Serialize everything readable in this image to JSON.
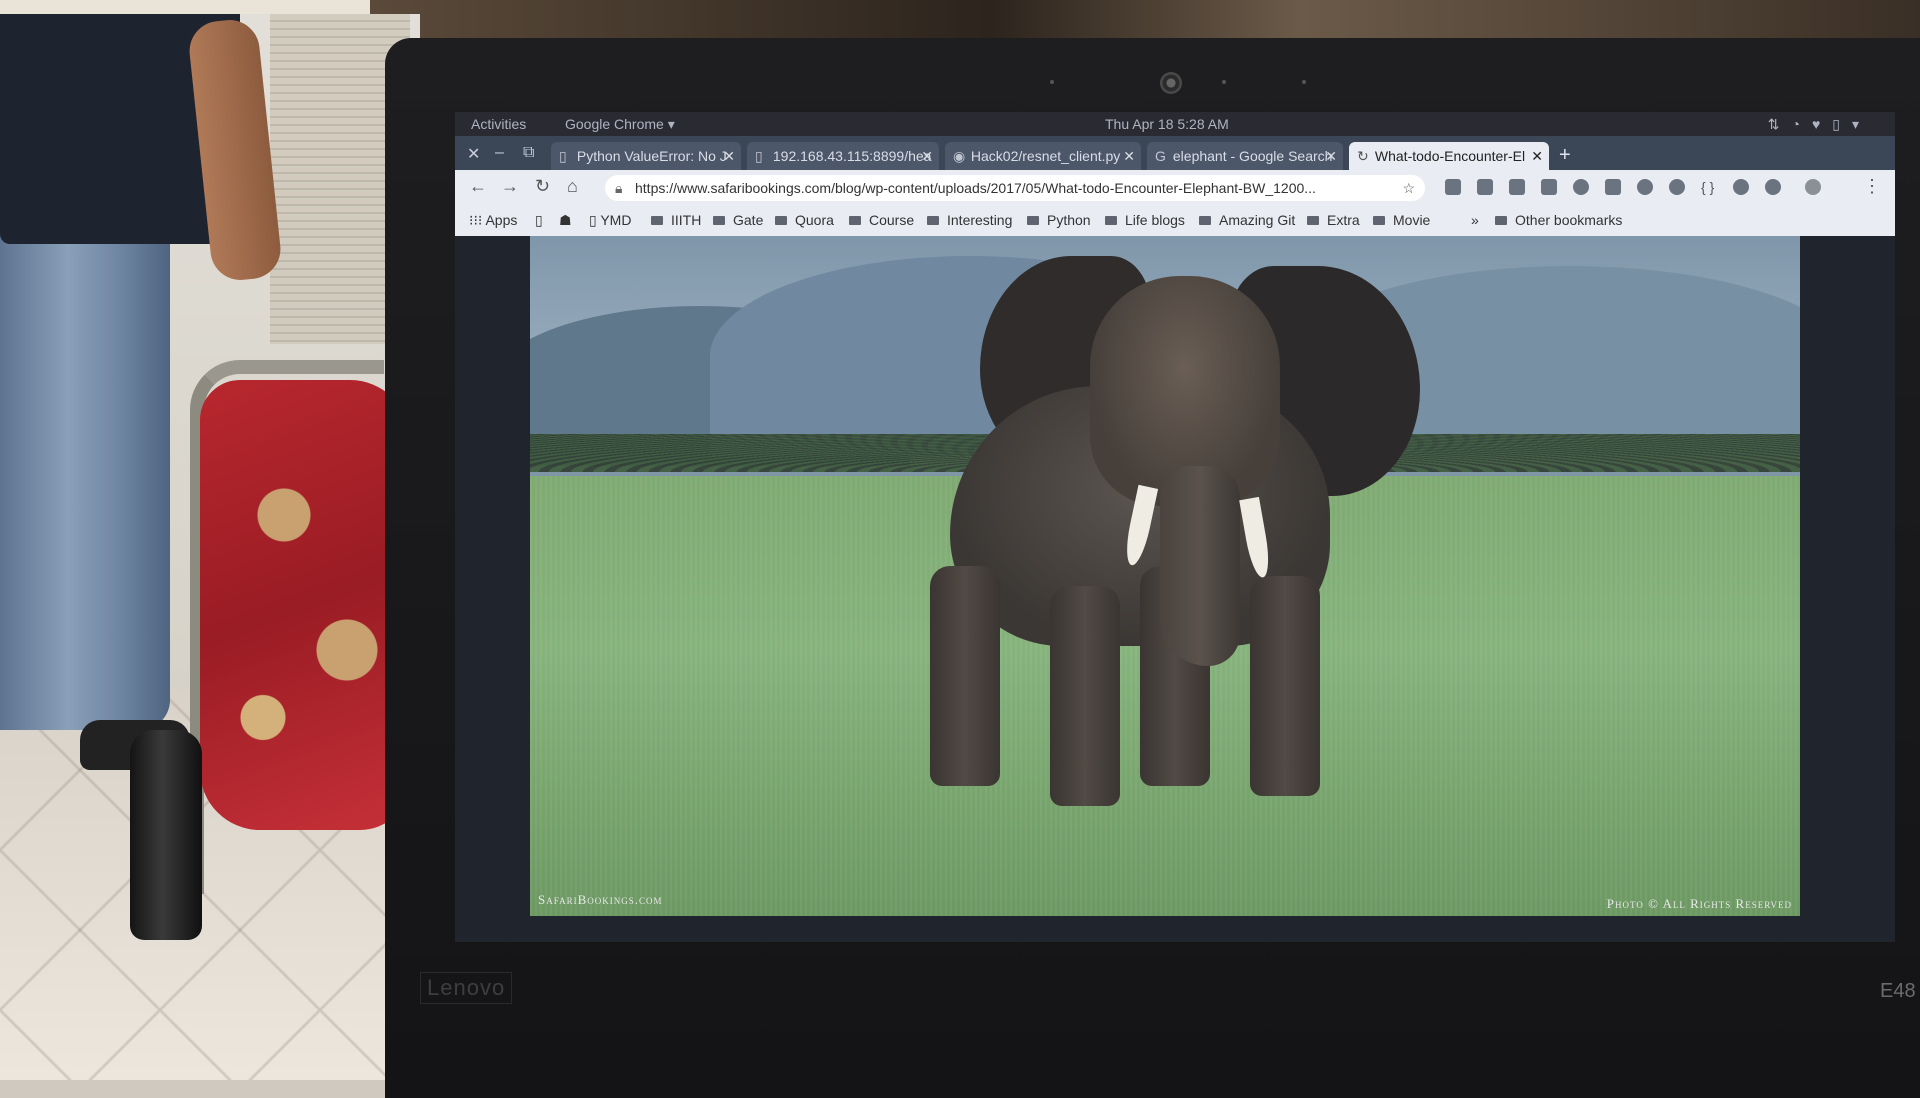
{
  "system_bar": {
    "activities": "Activities",
    "app_menu": "Google Chrome ▾",
    "clock": "Thu Apr 18  5:28 AM"
  },
  "tabs": [
    {
      "label": "Python ValueError: No J",
      "active": false
    },
    {
      "label": "192.168.43.115:8899/hea",
      "active": false
    },
    {
      "label": "Hack02/resnet_client.py",
      "active": false
    },
    {
      "label": "elephant - Google Search",
      "active": false
    },
    {
      "label": "What-todo-Encounter-El",
      "active": true
    }
  ],
  "address_bar": {
    "url": "https://www.safaribookings.com/blog/wp-content/uploads/2017/05/What-todo-Encounter-Elephant-BW_1200..."
  },
  "bookmarks": {
    "apps_label": "Apps",
    "items": [
      "YMD",
      "IIITH",
      "Gate",
      "Quora",
      "Course",
      "Interesting",
      "Python",
      "Life blogs",
      "Amazing Git",
      "Extra",
      "Movie"
    ],
    "overflow": "»",
    "other": "Other bookmarks"
  },
  "photo": {
    "caption_left": "SafariBookings.com",
    "caption_right": "Photo © All Rights Reserved"
  },
  "laptop": {
    "brand": "Lenovo",
    "model": "E48"
  }
}
